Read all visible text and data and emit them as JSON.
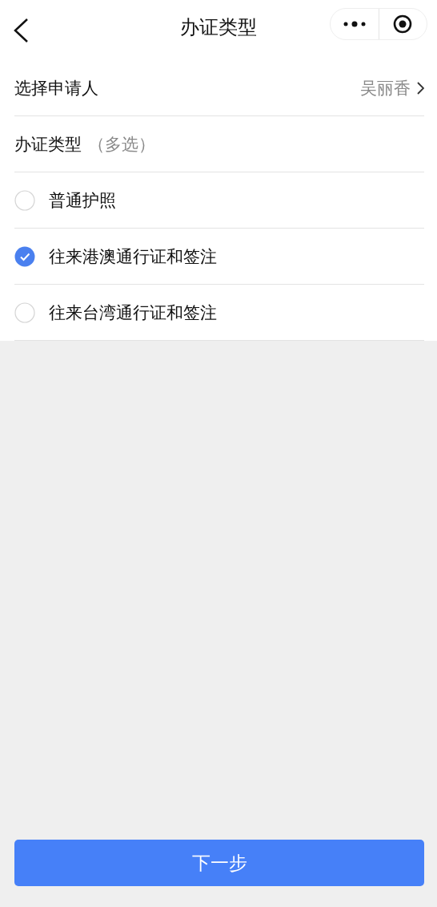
{
  "header": {
    "title": "办证类型"
  },
  "applicant": {
    "label": "选择申请人",
    "value": "吴丽香"
  },
  "type_section": {
    "label": "办证类型",
    "hint": "（多选）"
  },
  "options": [
    {
      "label": "普通护照",
      "checked": false
    },
    {
      "label": "往来港澳通行证和签注",
      "checked": true
    },
    {
      "label": "往来台湾通行证和签注",
      "checked": false
    }
  ],
  "next_button": {
    "label": "下一步"
  }
}
